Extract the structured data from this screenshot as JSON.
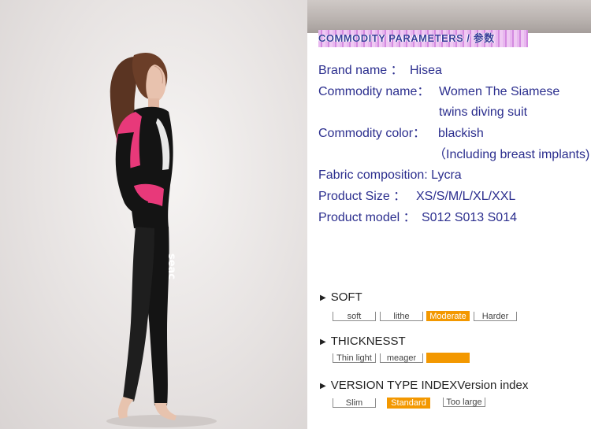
{
  "photo": {
    "logo_text": "seac",
    "alt_description_icon": "model-wetsuit-image"
  },
  "params_title": "COMMODITY PARAMETERS / 参数",
  "specs": [
    {
      "label": "Brand name ：",
      "value": "Hisea"
    },
    {
      "label": "Commodity name：",
      "value": "Women  The Siamese",
      "value2": "twins diving suit"
    },
    {
      "label": "Commodity color：",
      "value": "blackish",
      "value2": "（Including breast implants)"
    },
    {
      "label": "Fabric composition: Lycra",
      "value": ""
    },
    {
      "label": "Product Size   ：",
      "value": "XS/S/M/L/XL/XXL"
    },
    {
      "label": "Product model ：",
      "value": "S012  S013 S014"
    }
  ],
  "indicators": [
    {
      "title": "SOFT",
      "options": [
        "soft",
        "lithe",
        "Moderate",
        "Harder"
      ],
      "selected": 2
    },
    {
      "title": "THICKNESST",
      "options": [
        "Thin light",
        "meager",
        ""
      ],
      "selected": 2
    },
    {
      "title": "VERSION TYPE INDEXVersion index",
      "options": [
        "Slim",
        "Standard",
        "Too large"
      ],
      "selected": 1
    }
  ],
  "colors": {
    "accent": "#f39800",
    "spec_text": "#2b2e8e",
    "suit_pink": "#e8397a",
    "suit_black": "#141414"
  }
}
